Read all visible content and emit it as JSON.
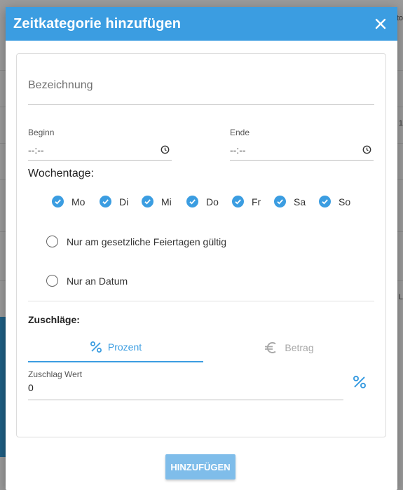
{
  "colors": {
    "accent": "#3b9de1",
    "button_disabled": "#7fbdea"
  },
  "background": {
    "edge_texts": [
      "to",
      "1",
      "L"
    ]
  },
  "dialog": {
    "title": "Zeitkategorie hinzufügen",
    "close_icon": "close-icon"
  },
  "form": {
    "name_placeholder": "Bezeichnung",
    "start": {
      "label": "Beginn",
      "value": "--:--"
    },
    "end": {
      "label": "Ende",
      "value": "--:--"
    },
    "weekdays_label": "Wochentage:",
    "weekdays": [
      {
        "label": "Mo",
        "checked": true
      },
      {
        "label": "Di",
        "checked": true
      },
      {
        "label": "Mi",
        "checked": true
      },
      {
        "label": "Do",
        "checked": true
      },
      {
        "label": "Fr",
        "checked": true
      },
      {
        "label": "Sa",
        "checked": true
      },
      {
        "label": "So",
        "checked": true
      }
    ],
    "radio_holidays": "Nur am gesetzliche Feiertagen gültig",
    "radio_date": "Nur an Datum",
    "surcharges_label": "Zuschläge:",
    "tabs": [
      {
        "label": "Prozent",
        "icon": "percent-icon",
        "active": true
      },
      {
        "label": "Betrag",
        "icon": "euro-icon",
        "active": false
      }
    ],
    "value": {
      "label": "Zuschlag Wert",
      "value": "0",
      "unit_icon": "percent-icon"
    }
  },
  "footer": {
    "add_button": "HINZUFÜGEN"
  }
}
